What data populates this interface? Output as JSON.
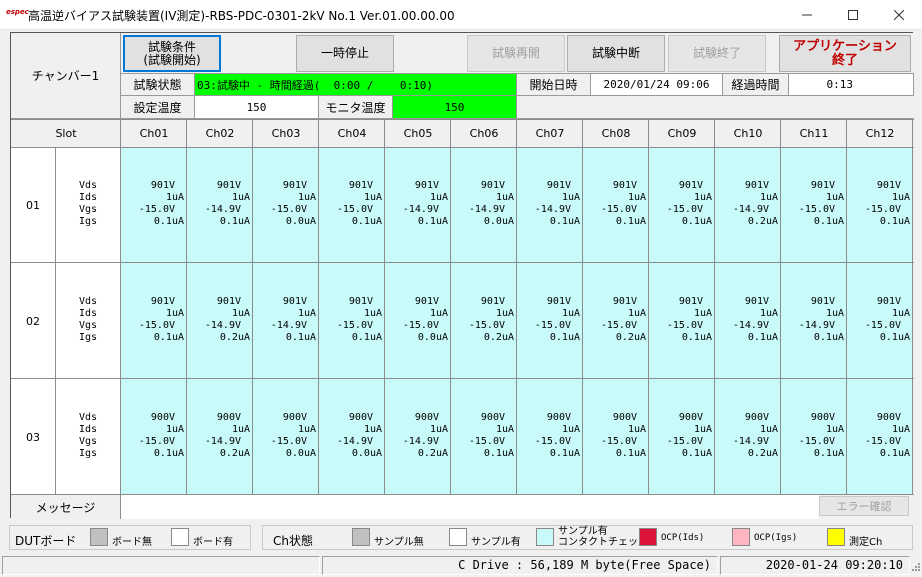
{
  "window": {
    "icon_text": "espec",
    "title": "高温逆バイアス試験装置(IV測定)-RBS-PDC-0301-2kV No.1 Ver.01.00.00.00"
  },
  "controls": {
    "chamber_label": "チャンバー1",
    "btn_condition": "試験条件\n(試験開始)",
    "btn_pause": "一時停止",
    "btn_resume": "試験再開",
    "btn_interrupt": "試験中断",
    "btn_finish": "試験終了",
    "btn_exit": "アプリケーション\n終了"
  },
  "status": {
    "state_label": "試験状態",
    "state_value": "03:試験中 - 時間経過(  0:00 /    0:10)",
    "start_label": "開始日時",
    "start_value": "2020/01/24 09:06",
    "elapsed_label": "経過時間",
    "elapsed_value": "0:13",
    "set_temp_label": "設定温度",
    "set_temp_value": "150",
    "monitor_temp_label": "モニタ温度",
    "monitor_temp_value": "150"
  },
  "grid": {
    "slot_header": "Slot",
    "channels": [
      "Ch01",
      "Ch02",
      "Ch03",
      "Ch04",
      "Ch05",
      "Ch06",
      "Ch07",
      "Ch08",
      "Ch09",
      "Ch10",
      "Ch11",
      "Ch12"
    ],
    "row_labels": [
      "Vds",
      "Ids",
      "Vgs",
      "Igs"
    ],
    "slots": [
      {
        "id": "01",
        "cells": [
          [
            "901V",
            "1uA",
            "-15.0V",
            "0.1uA"
          ],
          [
            "901V",
            "1uA",
            "-14.9V",
            "0.1uA"
          ],
          [
            "901V",
            "1uA",
            "-15.0V",
            "0.0uA"
          ],
          [
            "901V",
            "1uA",
            "-15.0V",
            "0.1uA"
          ],
          [
            "901V",
            "1uA",
            "-14.9V",
            "0.1uA"
          ],
          [
            "901V",
            "1uA",
            "-14.9V",
            "0.0uA"
          ],
          [
            "901V",
            "1uA",
            "-14.9V",
            "0.1uA"
          ],
          [
            "901V",
            "1uA",
            "-15.0V",
            "0.1uA"
          ],
          [
            "901V",
            "1uA",
            "-15.0V",
            "0.1uA"
          ],
          [
            "901V",
            "1uA",
            "-14.9V",
            "0.2uA"
          ],
          [
            "901V",
            "1uA",
            "-15.0V",
            "0.1uA"
          ],
          [
            "901V",
            "1uA",
            "-15.0V",
            "0.1uA"
          ]
        ]
      },
      {
        "id": "02",
        "cells": [
          [
            "901V",
            "1uA",
            "-15.0V",
            "0.1uA"
          ],
          [
            "901V",
            "1uA",
            "-14.9V",
            "0.2uA"
          ],
          [
            "901V",
            "1uA",
            "-14.9V",
            "0.1uA"
          ],
          [
            "901V",
            "1uA",
            "-15.0V",
            "0.1uA"
          ],
          [
            "901V",
            "1uA",
            "-15.0V",
            "0.0uA"
          ],
          [
            "901V",
            "1uA",
            "-15.0V",
            "0.2uA"
          ],
          [
            "901V",
            "1uA",
            "-15.0V",
            "0.1uA"
          ],
          [
            "901V",
            "1uA",
            "-15.0V",
            "0.2uA"
          ],
          [
            "901V",
            "1uA",
            "-15.0V",
            "0.1uA"
          ],
          [
            "901V",
            "1uA",
            "-14.9V",
            "0.1uA"
          ],
          [
            "901V",
            "1uA",
            "-14.9V",
            "0.1uA"
          ],
          [
            "901V",
            "1uA",
            "-15.0V",
            "0.1uA"
          ]
        ]
      },
      {
        "id": "03",
        "cells": [
          [
            "900V",
            "1uA",
            "-15.0V",
            "0.1uA"
          ],
          [
            "900V",
            "1uA",
            "-14.9V",
            "0.2uA"
          ],
          [
            "900V",
            "1uA",
            "-15.0V",
            "0.0uA"
          ],
          [
            "900V",
            "1uA",
            "-14.9V",
            "0.0uA"
          ],
          [
            "900V",
            "1uA",
            "-14.9V",
            "0.2uA"
          ],
          [
            "900V",
            "1uA",
            "-15.0V",
            "0.1uA"
          ],
          [
            "900V",
            "1uA",
            "-15.0V",
            "0.1uA"
          ],
          [
            "900V",
            "1uA",
            "-15.0V",
            "0.1uA"
          ],
          [
            "900V",
            "1uA",
            "-15.0V",
            "0.1uA"
          ],
          [
            "900V",
            "1uA",
            "-14.9V",
            "0.2uA"
          ],
          [
            "900V",
            "1uA",
            "-15.0V",
            "0.1uA"
          ],
          [
            "900V",
            "1uA",
            "-15.0V",
            "0.1uA"
          ]
        ]
      }
    ]
  },
  "message": {
    "label": "メッセージ",
    "value": "",
    "error_confirm": "エラー確認"
  },
  "legend": {
    "dut_label": "DUTボード",
    "dut_items": [
      {
        "label": "ボード無",
        "color": "#c0c0c0"
      },
      {
        "label": "ボード有",
        "color": "#ffffff"
      }
    ],
    "ch_label": "Ch状態",
    "ch_items": [
      {
        "label": "サンプル無",
        "color": "#c0c0c0"
      },
      {
        "label": "サンプル有",
        "color": "#ffffff"
      },
      {
        "label": "サンプル有\nコンタクトチェック",
        "color": "#c8fafa"
      },
      {
        "label": "OCP(Ids)",
        "color": "#dc143c"
      },
      {
        "label": "OCP(Igs)",
        "color": "#ffb6c1"
      },
      {
        "label": "測定Ch",
        "color": "#ffff00"
      }
    ]
  },
  "statusbar": {
    "drive": "C Drive : 56,189 M byte(Free Space)",
    "datetime": "2020-01-24 09:20:10"
  },
  "colors": {
    "state_bg": "#00ff00",
    "cell_bg": "#c8fafa"
  }
}
